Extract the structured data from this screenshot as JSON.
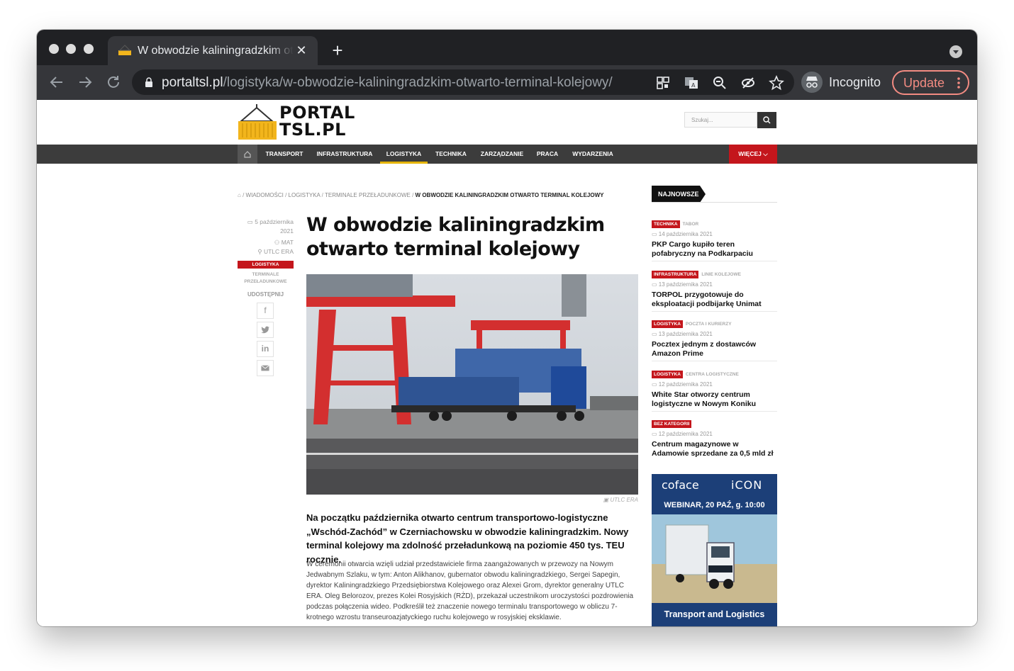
{
  "browser": {
    "tab_title": "W obwodzie kaliningradzkim otwarto terminal kolejowy",
    "url_host": "portaltsl.pl",
    "url_path": "/logistyka/w-obwodzie-kaliningradzkim-otwarto-terminal-kolejowy/",
    "incognito_label": "Incognito",
    "update_label": "Update",
    "tab_close_glyph": "✕",
    "new_tab_glyph": "+"
  },
  "site": {
    "logo_line1": "PORTAL",
    "logo_line2": "TSL.PL",
    "search_placeholder": "Szukaj...",
    "nav": [
      "TRANSPORT",
      "INFRASTRUKTURA",
      "LOGISTYKA",
      "TECHNIKA",
      "ZARZĄDZANIE",
      "PRACA",
      "WYDARZENIA"
    ],
    "nav_active": "LOGISTYKA",
    "nav_more": "WIĘCEJ ⌵"
  },
  "breadcrumb": {
    "items": [
      "WIADOMOŚCI",
      "LOGISTYKA",
      "TERMINALE PRZEŁADUNKOWE"
    ],
    "current": "W OBWODZIE KALININGRADZKIM OTWARTO TERMINAL KOLEJOWY"
  },
  "article": {
    "date_line1": "5 października",
    "date_line2": "2021",
    "author": "MAT",
    "source": "UTLC ERA",
    "category": "LOGISTYKA",
    "subcategory_line1": "TERMINALE",
    "subcategory_line2": "PRZEŁADUNKOWE",
    "share_label": "UDOSTĘPNIJ",
    "title": "W obwodzie kaliningradzkim otwarto terminal kolejowy",
    "photo_credit": "UTLC ERA",
    "lead": "Na początku października otwarto centrum transportowo-logistyczne „Wschód-Zachód” w Czerniachowsku w obwodzie kaliningradzkim. Nowy terminal kolejowy ma zdolność przeładunkową na poziomie 450 tys. TEU rocznie.",
    "body": "W ceremonii otwarcia wzięli udział przedstawiciele firma zaangażowanych w przewozy na Nowym Jedwabnym Szlaku, w tym: Anton Alikhanov, gubernator obwodu kaliningradzkiego, Sergei Sapegin, dyrektor Kaliningradzkiego Przedsiębiorstwa Kolejowego oraz Alexei Grom, dyrektor generalny UTLC ERA. Oleg Belorozov, prezes Kolei Rosyjskich (RŻD), przekazał uczestnikom uroczystości pozdrowienia podczas połączenia wideo. Podkreślił też znaczenie nowego terminalu transportowego w obliczu 7-krotnego wzrostu transeuroazjatyckiego ruchu kolejowego w rosyjskiej eksklawie."
  },
  "sidebar": {
    "heading": "NAJNOWSZE",
    "news": [
      {
        "badge": "TECHNIKA",
        "sub": "TABOR",
        "date": "14 października 2021",
        "title": "PKP Cargo kupiło teren pofabryczny na Podkarpaciu"
      },
      {
        "badge": "INFRASTRUKTURA",
        "sub": "LINIE KOLEJOWE",
        "date": "13 października 2021",
        "title": "TORPOL przygotowuje do eksploatacji podbijarkę Unimat"
      },
      {
        "badge": "LOGISTYKA",
        "sub": "POCZTA I KURIERZY",
        "date": "13 października 2021",
        "title": "Pocztex jednym z dostawców Amazon Prime"
      },
      {
        "badge": "LOGISTYKA",
        "sub": "CENTRA LOGISTYCZNE",
        "date": "12 października 2021",
        "title": "White Star otworzy centrum logistyczne w Nowym Koniku"
      },
      {
        "badge": "BEZ KATEGORII",
        "sub": "",
        "date": "12 października 2021",
        "title": "Centrum magazynowe w Adamowie sprzedane za 0,5 mld zł"
      }
    ],
    "ad": {
      "brand_left": "coface",
      "brand_right": "iCON",
      "headline": "WEBINAR, 20 PAŹ, g. 10:00",
      "footer": "Transport and Logistics"
    }
  }
}
